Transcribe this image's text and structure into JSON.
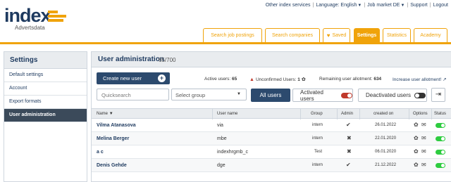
{
  "brand": {
    "word": "index",
    "sub": "Advertsdata",
    "accent": "#f0a30a",
    "navy": "#1e3a5f"
  },
  "topnav": {
    "other_services": "Other index services",
    "language": "Language: English",
    "job_market": "Job market DE",
    "support": "Support",
    "logout": "Logout"
  },
  "tabs": [
    {
      "label": "Search job postings"
    },
    {
      "label": "Search companies"
    },
    {
      "label": "Saved",
      "icon": "heart-icon"
    },
    {
      "label": "Settings",
      "active": true
    },
    {
      "label": "Statistics"
    },
    {
      "label": "Academy"
    }
  ],
  "sidebar": {
    "title": "Settings",
    "items": [
      {
        "label": "Default settings"
      },
      {
        "label": "Account"
      },
      {
        "label": "Export formats"
      },
      {
        "label": "User administration",
        "active": true
      }
    ]
  },
  "main": {
    "title": "User administration",
    "count": "65/700",
    "create_button": "Create new user",
    "active_users_label": "Active users:",
    "active_users_value": "65",
    "unconfirmed_label": "Unconfirmed Users:",
    "unconfirmed_value": "1",
    "remaining_label": "Remaining user allotment:",
    "remaining_value": "634",
    "increase_link": "Increase user allotment! ↗",
    "search_placeholder": "Quicksearch",
    "group_select": "Select group",
    "filter_all": "All users",
    "filter_activated": "Activated users",
    "filter_deactivated": "Deactivated users"
  },
  "table": {
    "headers": {
      "name": "Name",
      "username": "User name",
      "group": "Group",
      "admin": "Admin",
      "created": "created on",
      "options": "Options",
      "status": "Status"
    },
    "rows": [
      {
        "name": "Vilma Atanasova",
        "username": "via",
        "group": "intern",
        "admin": true,
        "created": "26.01.2022",
        "status": "active"
      },
      {
        "name": "Melina Berger",
        "username": "mbe",
        "group": "intern",
        "admin": false,
        "created": "22.01.2020",
        "status": "active"
      },
      {
        "name": "a c",
        "username": "indexhrgmb_c",
        "group": "Test",
        "admin": false,
        "created": "06.01.2020",
        "status": "active"
      },
      {
        "name": "Denis Gehde",
        "username": "dge",
        "group": "intern",
        "admin": true,
        "created": "21.12.2022",
        "status": "active"
      }
    ]
  }
}
